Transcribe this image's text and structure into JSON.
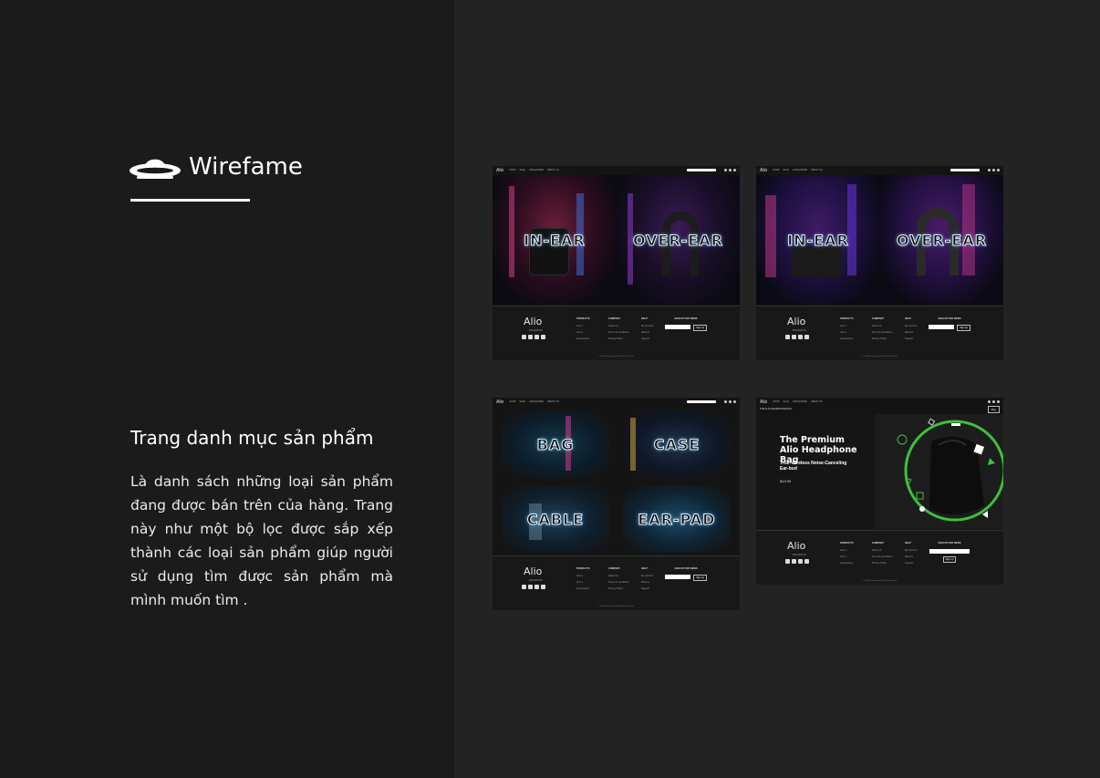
{
  "header": {
    "title": "Wirefame",
    "logo_icon": "ufo-icon"
  },
  "section": {
    "title": "Trang danh mục sản phẩm",
    "description": "Là danh sách những loại sản phẩm đang được bán trên của hàng. Trang này như một bộ lọc được sắp xếp thành các loại sản phẩm giúp người sử dụng tìm được sản phẩm mà mình muốn tìm ."
  },
  "mockups": {
    "brand": "Alio",
    "nav_links": [
      "SHOP",
      "SALE",
      "CATEGORIES",
      "ABOUT US"
    ],
    "footer": {
      "follow": "FOLLOW US",
      "products": {
        "head": "PRODUCTS",
        "items": [
          "Item 1",
          "Item 2",
          "Accessories"
        ]
      },
      "company": {
        "head": "COMPANY",
        "items": [
          "About Us",
          "Terms & Conditions",
          "Privacy Policy"
        ]
      },
      "help": {
        "head": "HELP",
        "items": [
          "My Account",
          "Returns",
          "Support"
        ]
      },
      "signup": {
        "head": "SIGN UP FOR NEWS",
        "button": "Sign up"
      },
      "copyright": "© 2020 Alio Company. All Rights Reserved."
    },
    "screen1": {
      "categories": [
        "IN-EAR",
        "OVER-EAR"
      ]
    },
    "screen2": {
      "categories": [
        "IN-EAR",
        "OVER-EAR"
      ]
    },
    "screen3": {
      "categories": [
        "BAG",
        "CASE",
        "CABLE",
        "EAR-PAD"
      ]
    },
    "screen4": {
      "breadcrumb": "THE ALIO HEADPHONE BAG",
      "buy_label": "Buy",
      "product_title": "The Premium Alio Headphone Bag",
      "product_subtitle": "True-Wireless Noise-Canceling Ear-bud",
      "price": "$19.99"
    }
  },
  "colors": {
    "left_bg": "#1b1b1b",
    "right_bg": "#232323",
    "accent_green": "#3fbf3f",
    "neon_pink": "#e0409a",
    "neon_blue": "#3f8bff"
  }
}
